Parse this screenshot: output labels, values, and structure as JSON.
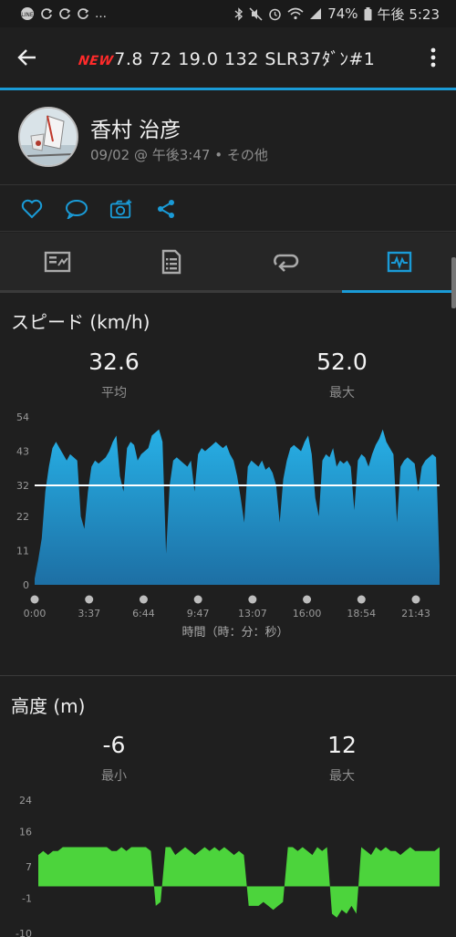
{
  "status": {
    "left_icons": [
      "line-icon",
      "sync-icon",
      "sync-icon",
      "sync-icon"
    ],
    "dots": "…",
    "battery": "74%",
    "time": "午後 5:23"
  },
  "appbar": {
    "new_badge": "NEW",
    "title": "7.8  72  19.0  132  SLR37ﾀﾞﾝ#1"
  },
  "activity": {
    "user_name": "香村 治彦",
    "subtitle": "09/02 @ 午後3:47 • その他"
  },
  "colors": {
    "accent": "#1a9bd7",
    "speed_fill": "#2aa6d8",
    "elev_fill": "#4cd43c"
  },
  "speed": {
    "title": "スピード (km/h)",
    "avg_value": "32.6",
    "avg_label": "平均",
    "max_value": "52.0",
    "max_label": "最大",
    "x_axis_label": "時間（時：分：秒）"
  },
  "elevation": {
    "title": "高度 (m)",
    "min_value": "-6",
    "min_label": "最小",
    "max_value": "12",
    "max_label": "最大"
  },
  "chart_data": [
    {
      "type": "area",
      "title": "スピード (km/h)",
      "xlabel": "時間（時：分：秒）",
      "ylabel": "",
      "ylim": [
        0,
        54
      ],
      "y_ticks": [
        "54",
        "43",
        "32",
        "22",
        "11",
        "0"
      ],
      "x_ticks": [
        "0:00",
        "3:37",
        "6:44",
        "9:47",
        "13:07",
        "16:00",
        "18:54",
        "21:43"
      ],
      "reference_line": 32,
      "series": [
        {
          "values": [
            2,
            8,
            15,
            30,
            38,
            44,
            46,
            44,
            42,
            40,
            42,
            41,
            40,
            22,
            18,
            30,
            38,
            40,
            39,
            40,
            41,
            43,
            46,
            48,
            35,
            30,
            44,
            46,
            45,
            40,
            42,
            43,
            44,
            48,
            49,
            50,
            46,
            10,
            32,
            40,
            41,
            40,
            39,
            38,
            40,
            30,
            42,
            44,
            43,
            44,
            45,
            46,
            45,
            44,
            45,
            42,
            40,
            35,
            28,
            20,
            38,
            40,
            39,
            38,
            40,
            37,
            38,
            36,
            32,
            20,
            34,
            40,
            44,
            45,
            44,
            43,
            46,
            48,
            42,
            28,
            22,
            40,
            42,
            41,
            44,
            38,
            40,
            39,
            40,
            38,
            24,
            40,
            42,
            41,
            38,
            42,
            45,
            47,
            50,
            46,
            44,
            42,
            20,
            38,
            40,
            41,
            40,
            39,
            30,
            38,
            40,
            41,
            42,
            41,
            6
          ]
        }
      ]
    },
    {
      "type": "area",
      "title": "高度 (m)",
      "ylim": [
        -10,
        24
      ],
      "y_ticks": [
        "24",
        "16",
        "7",
        "-1",
        "-10"
      ],
      "series": [
        {
          "values": [
            10,
            11,
            10,
            11,
            11,
            12,
            12,
            12,
            12,
            12,
            12,
            12,
            12,
            12,
            12,
            11,
            11,
            12,
            11,
            12,
            12,
            12,
            12,
            11,
            -3,
            -2,
            12,
            12,
            10,
            11,
            12,
            11,
            10,
            11,
            12,
            11,
            12,
            11,
            12,
            11,
            10,
            11,
            10,
            -3,
            -3,
            -3,
            -2,
            -3,
            -4,
            -3,
            -2,
            12,
            12,
            11,
            12,
            11,
            10,
            12,
            11,
            12,
            -5,
            -6,
            -4,
            -5,
            -3,
            -5,
            12,
            11,
            10,
            12,
            11,
            12,
            11,
            11,
            10,
            11,
            12,
            11,
            11,
            11,
            11,
            11,
            12
          ]
        }
      ]
    }
  ]
}
